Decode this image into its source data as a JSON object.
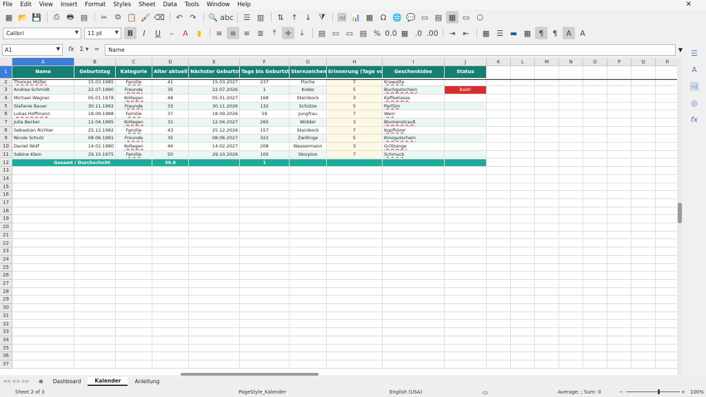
{
  "menu": [
    "File",
    "Edit",
    "View",
    "Insert",
    "Format",
    "Styles",
    "Sheet",
    "Data",
    "Tools",
    "Window",
    "Help"
  ],
  "font": {
    "name": "Calibri",
    "size": "11 pt"
  },
  "namebox": "A1",
  "formula": "Name",
  "columns": [
    "A",
    "B",
    "C",
    "D",
    "E",
    "F",
    "G",
    "H",
    "I",
    "J",
    "K",
    "L",
    "M",
    "N",
    "O",
    "P",
    "Q",
    "R"
  ],
  "headers": [
    "Name",
    "Geburtstag",
    "Kategorie",
    "Alter aktuell",
    "Nächster Geburtstag",
    "Tage bis Geburtstag",
    "Sternzeichen",
    "Erinnerung (Tage vorher)",
    "Geschenkidee",
    "Status"
  ],
  "rows": [
    {
      "name": "Thomas Müller",
      "birthday": "15.03.1985",
      "category": "Familie",
      "age": "41",
      "next": "15.03.2027",
      "days": "237",
      "sign": "Fische",
      "reminder": "7",
      "gift": "Krawatte",
      "status": ""
    },
    {
      "name": "Andrea Schmidt",
      "birthday": "22.07.1990",
      "category": "Freunde",
      "age": "35",
      "next": "22.07.2026",
      "days": "1",
      "sign": "Krebs",
      "reminder": "5",
      "gift": "Buchgutschein",
      "status": "Bald!"
    },
    {
      "name": "Michael Wagner",
      "birthday": "05.01.1978",
      "category": "Kollegen",
      "age": "48",
      "next": "05.01.2027",
      "days": "168",
      "sign": "Steinbock",
      "reminder": "3",
      "gift": "Kaffeetasse",
      "status": ""
    },
    {
      "name": "Stefanie Bauer",
      "birthday": "30.11.1992",
      "category": "Freunde",
      "age": "33",
      "next": "30.11.2026",
      "days": "132",
      "sign": "Schütze",
      "reminder": "5",
      "gift": "Parfüm",
      "status": ""
    },
    {
      "name": "Lukas Hoffmann",
      "birthday": "18.09.1988",
      "category": "Familie",
      "age": "37",
      "next": "18.09.2026",
      "days": "59",
      "sign": "Jungfrau",
      "reminder": "7",
      "gift": "Wein",
      "status": ""
    },
    {
      "name": "Julia Becker",
      "birthday": "12.04.1995",
      "category": "Kollegen",
      "age": "31",
      "next": "12.04.2027",
      "days": "265",
      "sign": "Widder",
      "reminder": "3",
      "gift": "Blumenstrauß",
      "status": ""
    },
    {
      "name": "Sebastian Richter",
      "birthday": "25.12.1982",
      "category": "Familie",
      "age": "43",
      "next": "25.12.2026",
      "days": "157",
      "sign": "Steinbock",
      "reminder": "7",
      "gift": "Kopfhörer",
      "status": ""
    },
    {
      "name": "Nicole Schulz",
      "birthday": "08.06.1991",
      "category": "Freunde",
      "age": "35",
      "next": "08.06.2027",
      "days": "322",
      "sign": "Zwillinge",
      "reminder": "5",
      "gift": "Kinogutschein",
      "status": ""
    },
    {
      "name": "Daniel Wolf",
      "birthday": "14.02.1980",
      "category": "Kollegen",
      "age": "46",
      "next": "14.02.2027",
      "days": "208",
      "sign": "Wassermann",
      "reminder": "3",
      "gift": "Grillzange",
      "status": ""
    },
    {
      "name": "Sabine Klein",
      "birthday": "29.10.1975",
      "category": "Familie",
      "age": "50",
      "next": "29.10.2026",
      "days": "100",
      "sign": "Skorpion",
      "reminder": "7",
      "gift": "Schmuck",
      "status": ""
    }
  ],
  "totals": {
    "label": "Gesamt / Durchschnitt",
    "avg_age": "39.9",
    "count_soon": "1"
  },
  "tabs": [
    "Dashboard",
    "Kalender",
    "Anleitung"
  ],
  "active_tab": "Kalender",
  "status": {
    "sheet": "Sheet 2 of 3",
    "pagestyle": "PageStyle_Kalender",
    "language": "English (USA)",
    "sum": "Average: ; Sum: 0",
    "zoom": "100%"
  },
  "colors": {
    "header": "#157f72",
    "total": "#1dab9a",
    "alert": "#d62e2e",
    "selection": "#3d7ed8"
  }
}
